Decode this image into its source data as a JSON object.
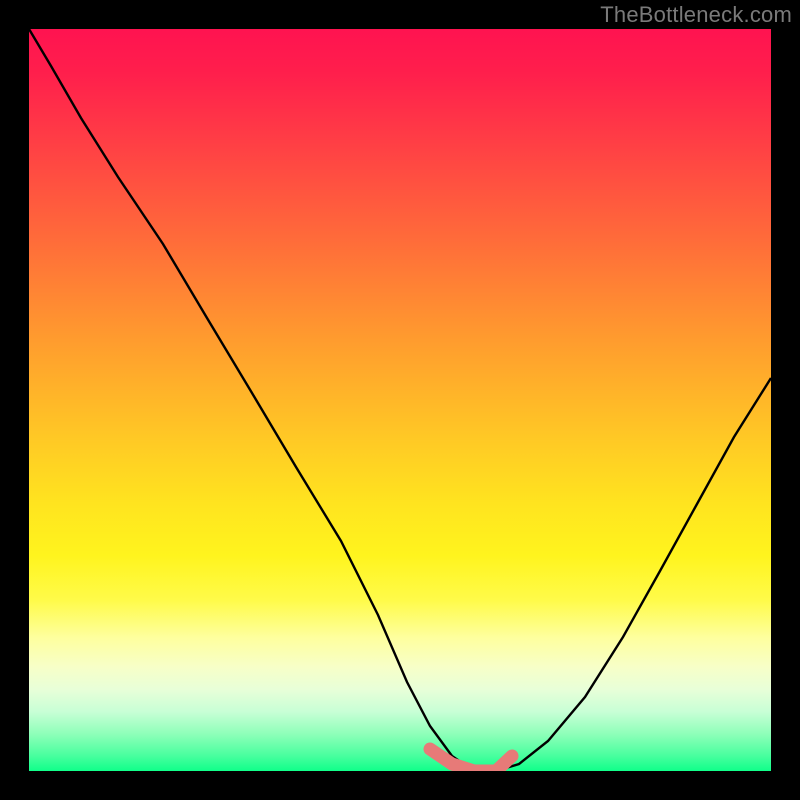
{
  "watermark": "TheBottleneck.com",
  "colors": {
    "page_bg": "#000000",
    "watermark_text": "#7a7a7a",
    "curve_stroke": "#000000",
    "marker_fill": "#e77a78",
    "gradient_stops": [
      "#ff1350",
      "#ff1f4c",
      "#ff3a46",
      "#ff6a3a",
      "#ff9c2e",
      "#ffc825",
      "#ffe41f",
      "#fff41e",
      "#fffb4a",
      "#feff9e",
      "#f7ffc8",
      "#e8ffd8",
      "#c8ffd6",
      "#8effb9",
      "#47ff9e",
      "#10ff8a"
    ]
  },
  "chart_data": {
    "type": "line",
    "title": "",
    "xlabel": "",
    "ylabel": "",
    "xlim": [
      0,
      100
    ],
    "ylim": [
      0,
      100
    ],
    "grid": false,
    "legend": false,
    "series": [
      {
        "name": "bottleneck-curve",
        "x": [
          0,
          3,
          7,
          12,
          18,
          24,
          30,
          36,
          42,
          47,
          51,
          54,
          57,
          60,
          63,
          66,
          70,
          75,
          80,
          85,
          90,
          95,
          100
        ],
        "y": [
          100,
          95,
          88,
          80,
          71,
          61,
          51,
          41,
          31,
          21,
          12,
          6,
          2,
          0,
          0,
          1,
          4,
          10,
          18,
          27,
          36,
          45,
          53
        ]
      },
      {
        "name": "flat-minimum-marker",
        "x": [
          54,
          57,
          60,
          63,
          65
        ],
        "y": [
          3,
          1,
          0,
          0,
          2
        ]
      }
    ],
    "annotations": []
  }
}
